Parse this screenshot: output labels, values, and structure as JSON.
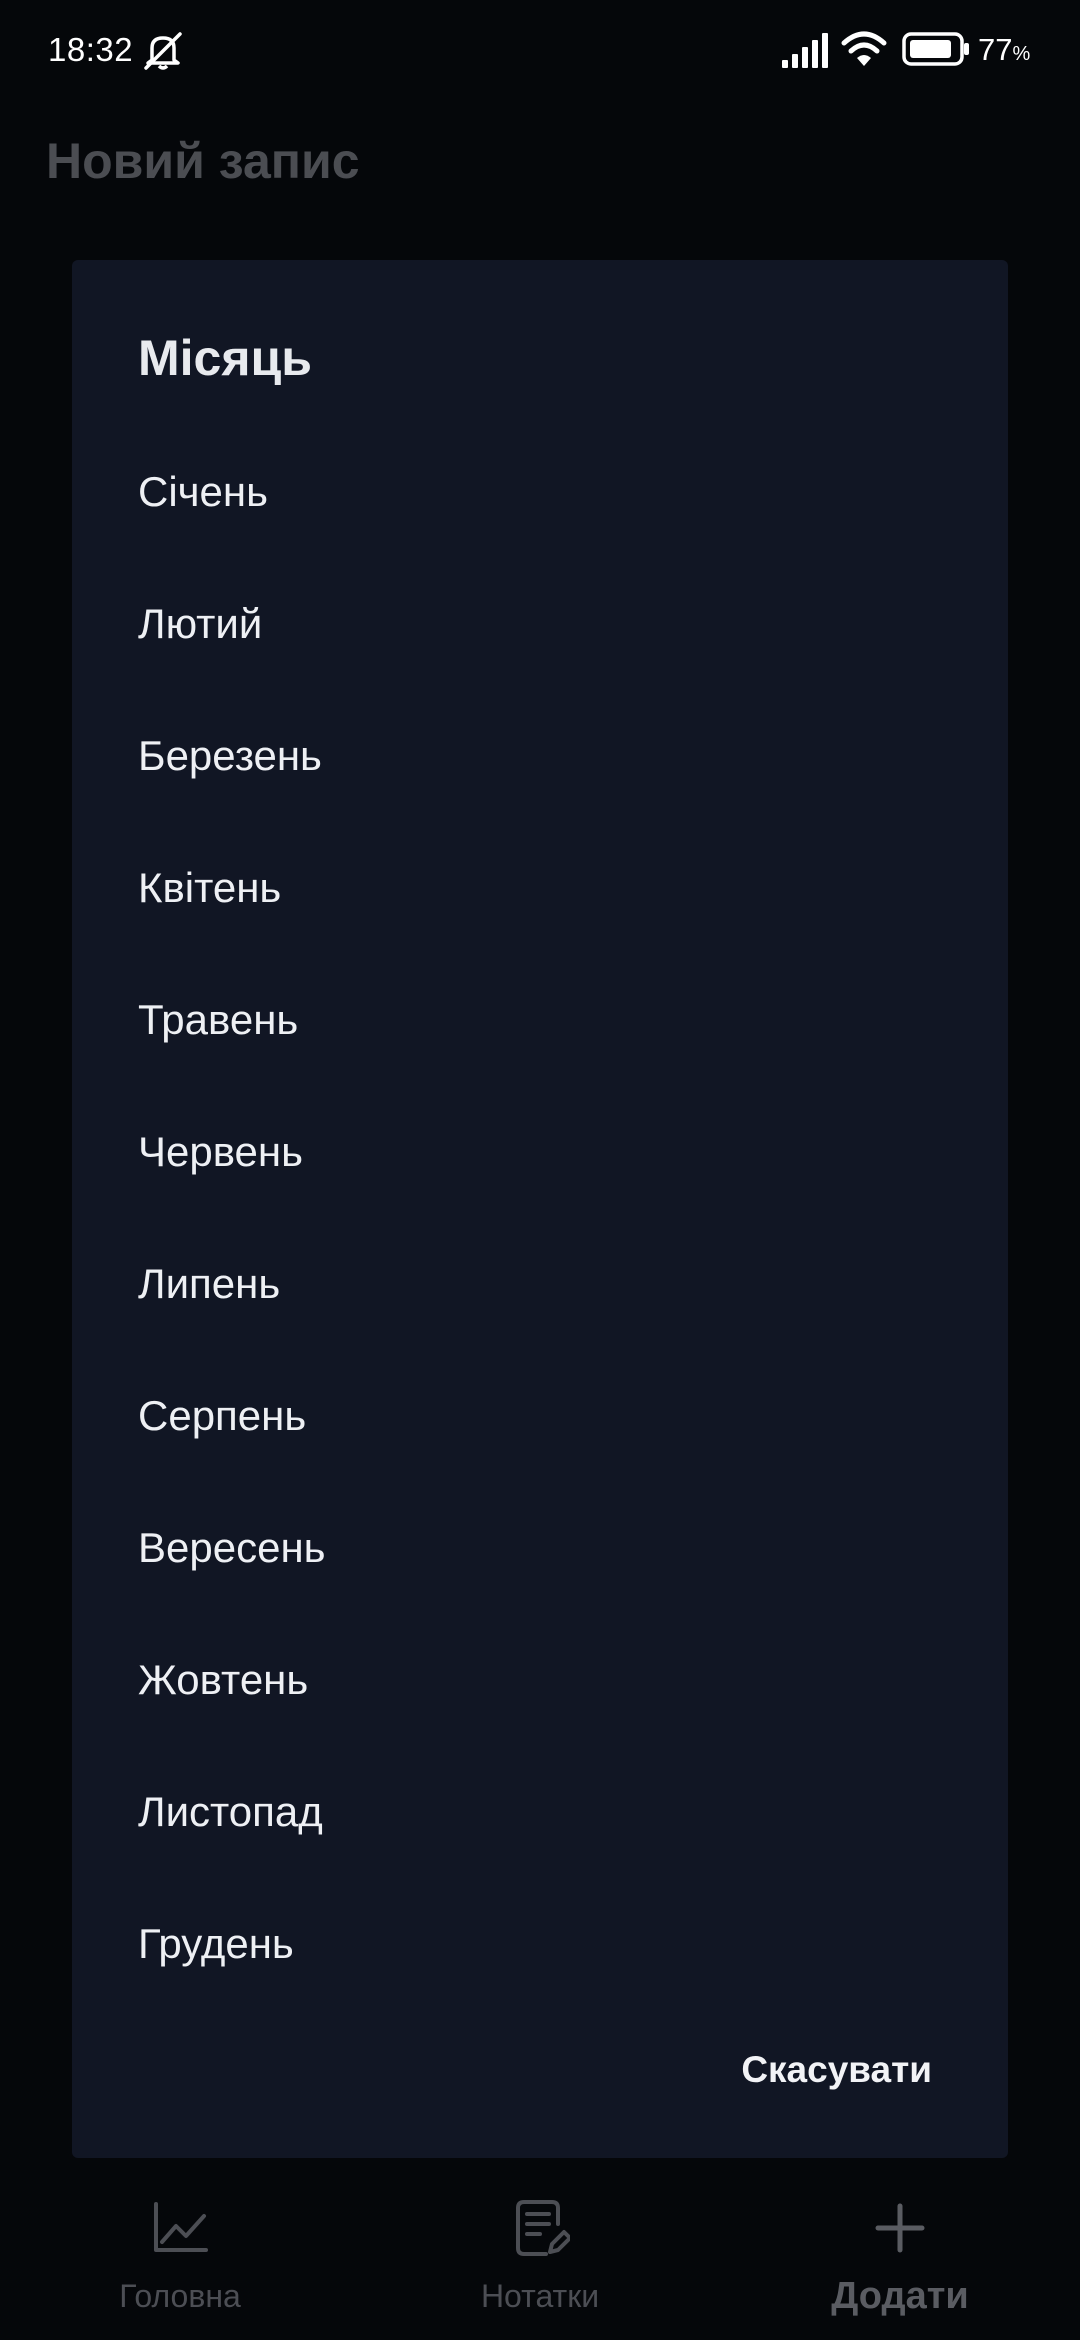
{
  "status_bar": {
    "time": "18:32",
    "battery_percent": "77",
    "battery_unit": "%",
    "icons": [
      "mute-bell-icon",
      "signal-icon",
      "wifi-icon",
      "battery-icon"
    ]
  },
  "header": {
    "title": "Новий запис"
  },
  "dialog": {
    "title": "Місяць",
    "months": [
      {
        "label": "Січень"
      },
      {
        "label": "Лютий"
      },
      {
        "label": "Березень"
      },
      {
        "label": "Квітень"
      },
      {
        "label": "Травень"
      },
      {
        "label": "Червень"
      },
      {
        "label": "Липень"
      },
      {
        "label": "Серпень"
      },
      {
        "label": "Вересень"
      },
      {
        "label": "Жовтень"
      },
      {
        "label": "Листопад"
      },
      {
        "label": "Грудень"
      }
    ],
    "cancel_label": "Скасувати"
  },
  "bottom_nav": {
    "items": [
      {
        "label": "Головна",
        "icon": "chart-line-icon"
      },
      {
        "label": "Нотатки",
        "icon": "notes-edit-icon"
      },
      {
        "label": "Додати",
        "icon": "plus-icon",
        "active": true
      }
    ]
  },
  "colors": {
    "background": "#05070a",
    "dialog": "#111624",
    "text": "#eef0f4",
    "dimmed_text": "#4b4d52"
  }
}
